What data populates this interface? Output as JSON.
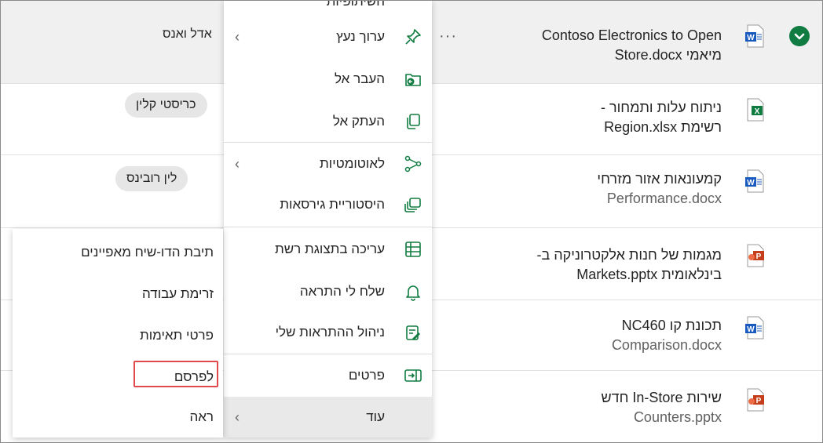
{
  "rows": [
    {
      "line1": "Contoso Electronics to Open",
      "line2": "מיאמי Store.docx",
      "type": "word",
      "owner": "אדל ואנס",
      "owner_style": "plain",
      "selected": true
    },
    {
      "line1": "ניתוח עלות ותמחור -",
      "line2": "רשימת Region.xlsx",
      "type": "excel",
      "owner": "כריסטי קלין",
      "owner_style": "pill",
      "selected": false
    },
    {
      "line1": "קמעונאות אזור מזרחי",
      "line2": "Performance.docx",
      "type": "word",
      "owner": "לין רובינס",
      "owner_style": "pill",
      "selected": false
    },
    {
      "line1": "מגמות של חנות אלקטרוניקה ב-",
      "line2": "בינלאומית Markets.pptx",
      "type": "ppt",
      "owner": "",
      "owner_style": "none",
      "selected": false
    },
    {
      "line1": "תכונת קו NC460",
      "line2": "Comparison.docx",
      "type": "word",
      "owner": "",
      "owner_style": "none",
      "selected": false
    },
    {
      "line1": "שירות In-Store חדש",
      "line2": "Counters.pptx",
      "type": "ppt",
      "owner": "",
      "owner_style": "none",
      "selected": false
    }
  ],
  "file_icons": {
    "word": "W",
    "excel": "X",
    "ppt": "P"
  },
  "colors": {
    "word": "#185abd",
    "excel": "#107c41",
    "ppt": "#c43e1c",
    "check": "#107c41",
    "highlight": "#e0484b"
  },
  "menu": {
    "top_peek": "השיתופיות",
    "items": [
      {
        "label": "ערוך נעץ",
        "icon": "pin-icon",
        "submenu": true
      },
      {
        "label": "העבר אל",
        "icon": "move-to-icon",
        "submenu": false
      },
      {
        "label": "העתק אל",
        "icon": "copy-to-icon",
        "submenu": false
      },
      {
        "label": "לאוטומטיות",
        "icon": "automate-icon",
        "submenu": true
      },
      {
        "label": "היסטוריית גירסאות",
        "icon": "version-history-icon",
        "submenu": false
      },
      {
        "label": "עריכה בתצוגת רשת",
        "icon": "grid-view-icon",
        "submenu": false
      },
      {
        "label": "שלח לי התראה",
        "icon": "bell-icon",
        "submenu": false
      },
      {
        "label": "ניהול ההתראות שלי",
        "icon": "manage-alerts-icon",
        "submenu": false
      },
      {
        "label": "פרטים",
        "icon": "details-icon",
        "submenu": false
      },
      {
        "label": "עוד",
        "icon": "",
        "submenu": true
      }
    ]
  },
  "submenu": {
    "items": [
      "תיבת הדו-שיח מאפיינים",
      "זרימת עבודה",
      "פרטי תאימות",
      "לפרסם",
      "ראה"
    ],
    "highlighted": "לפרסם"
  }
}
